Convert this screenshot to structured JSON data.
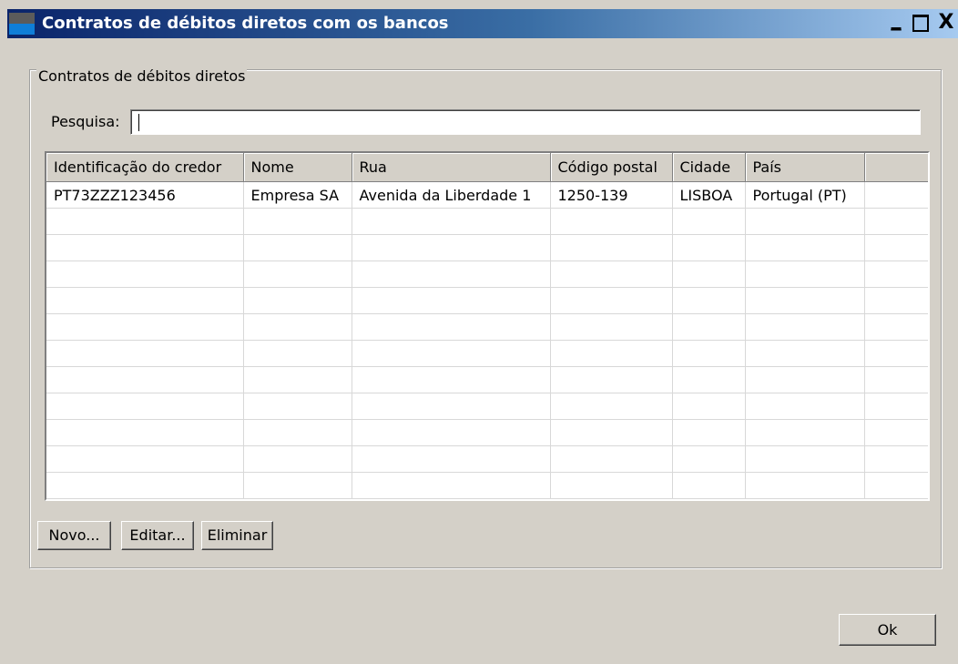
{
  "window": {
    "title": "Contratos de débitos diretos com os bancos",
    "controls": {
      "minimize": "_",
      "close": "X"
    }
  },
  "group": {
    "legend": "Contratos de débitos diretos"
  },
  "search": {
    "label": "Pesquisa:",
    "value": ""
  },
  "table": {
    "columns": [
      "Identificação do credor",
      "Nome",
      "Rua",
      "Código postal",
      "Cidade",
      "País",
      ""
    ],
    "rows": [
      [
        "PT73ZZZ123456",
        "Empresa SA",
        "Avenida da Liberdade 1",
        "1250-139",
        "LISBOA",
        "Portugal (PT)",
        ""
      ]
    ]
  },
  "buttons": {
    "new": "Novo...",
    "edit": "Editar...",
    "delete": "Eliminar",
    "ok": "Ok"
  },
  "colors": {
    "titlebar_start": "#0a246a",
    "titlebar_end": "#a6caf0",
    "face": "#d4d0c8"
  }
}
